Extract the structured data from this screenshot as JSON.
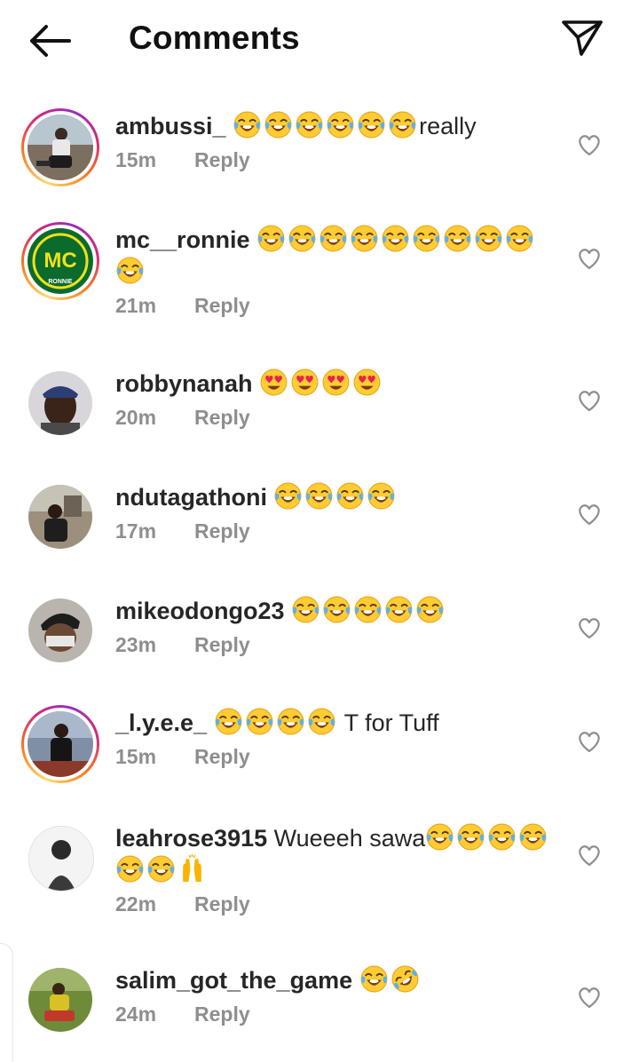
{
  "header": {
    "title": "Comments",
    "back_icon": "arrow-left-icon",
    "share_icon": "paper-plane-icon"
  },
  "colors": {
    "text": "#262626",
    "muted": "#8e8e8e",
    "story_ring": [
      "#feda75",
      "#fa7e1e",
      "#d62976",
      "#962fbf"
    ]
  },
  "comments": [
    {
      "username": "ambussi_",
      "text_after": "really",
      "emoji_before": [
        "joy",
        "joy",
        "joy",
        "joy",
        "joy",
        "joy"
      ],
      "time": "15m",
      "reply_label": "Reply",
      "story_ring": true
    },
    {
      "username": "mc__ronnie",
      "text_after": "",
      "emoji_before": [
        "joy",
        "joy",
        "joy",
        "joy",
        "joy",
        "joy",
        "joy",
        "joy",
        "joy",
        "joy"
      ],
      "time": "21m",
      "reply_label": "Reply",
      "story_ring": true,
      "avatar_text": "MC",
      "avatar_subtext": "RONNIE"
    },
    {
      "username": "robbynanah",
      "text_after": "",
      "emoji_before": [
        "heart-eyes",
        "heart-eyes",
        "heart-eyes",
        "heart-eyes"
      ],
      "time": "20m",
      "reply_label": "Reply",
      "story_ring": false
    },
    {
      "username": "ndutagathoni",
      "text_after": "",
      "emoji_before": [
        "joy",
        "joy",
        "joy",
        "joy"
      ],
      "time": "17m",
      "reply_label": "Reply",
      "story_ring": false
    },
    {
      "username": "mikeodongo23",
      "text_after": "",
      "emoji_before": [
        "joy",
        "joy",
        "joy",
        "joy",
        "joy"
      ],
      "time": "23m",
      "reply_label": "Reply",
      "story_ring": false
    },
    {
      "username": "_l.y.e.e_",
      "text_after": " T for Tuff",
      "emoji_before": [
        "joy",
        "joy",
        "joy",
        "joy"
      ],
      "time": "15m",
      "reply_label": "Reply",
      "story_ring": true
    },
    {
      "username": "leahrose3915",
      "text_before": "Wueeeh sawa",
      "text_after": "",
      "emoji_before": [
        "joy",
        "joy",
        "joy",
        "joy",
        "joy",
        "joy",
        "raised-hands"
      ],
      "time": "22m",
      "reply_label": "Reply",
      "story_ring": false
    },
    {
      "username": "salim_got_the_game",
      "text_after": "",
      "emoji_before": [
        "joy",
        "rofl"
      ],
      "time": "24m",
      "reply_label": "Reply",
      "story_ring": false
    }
  ]
}
